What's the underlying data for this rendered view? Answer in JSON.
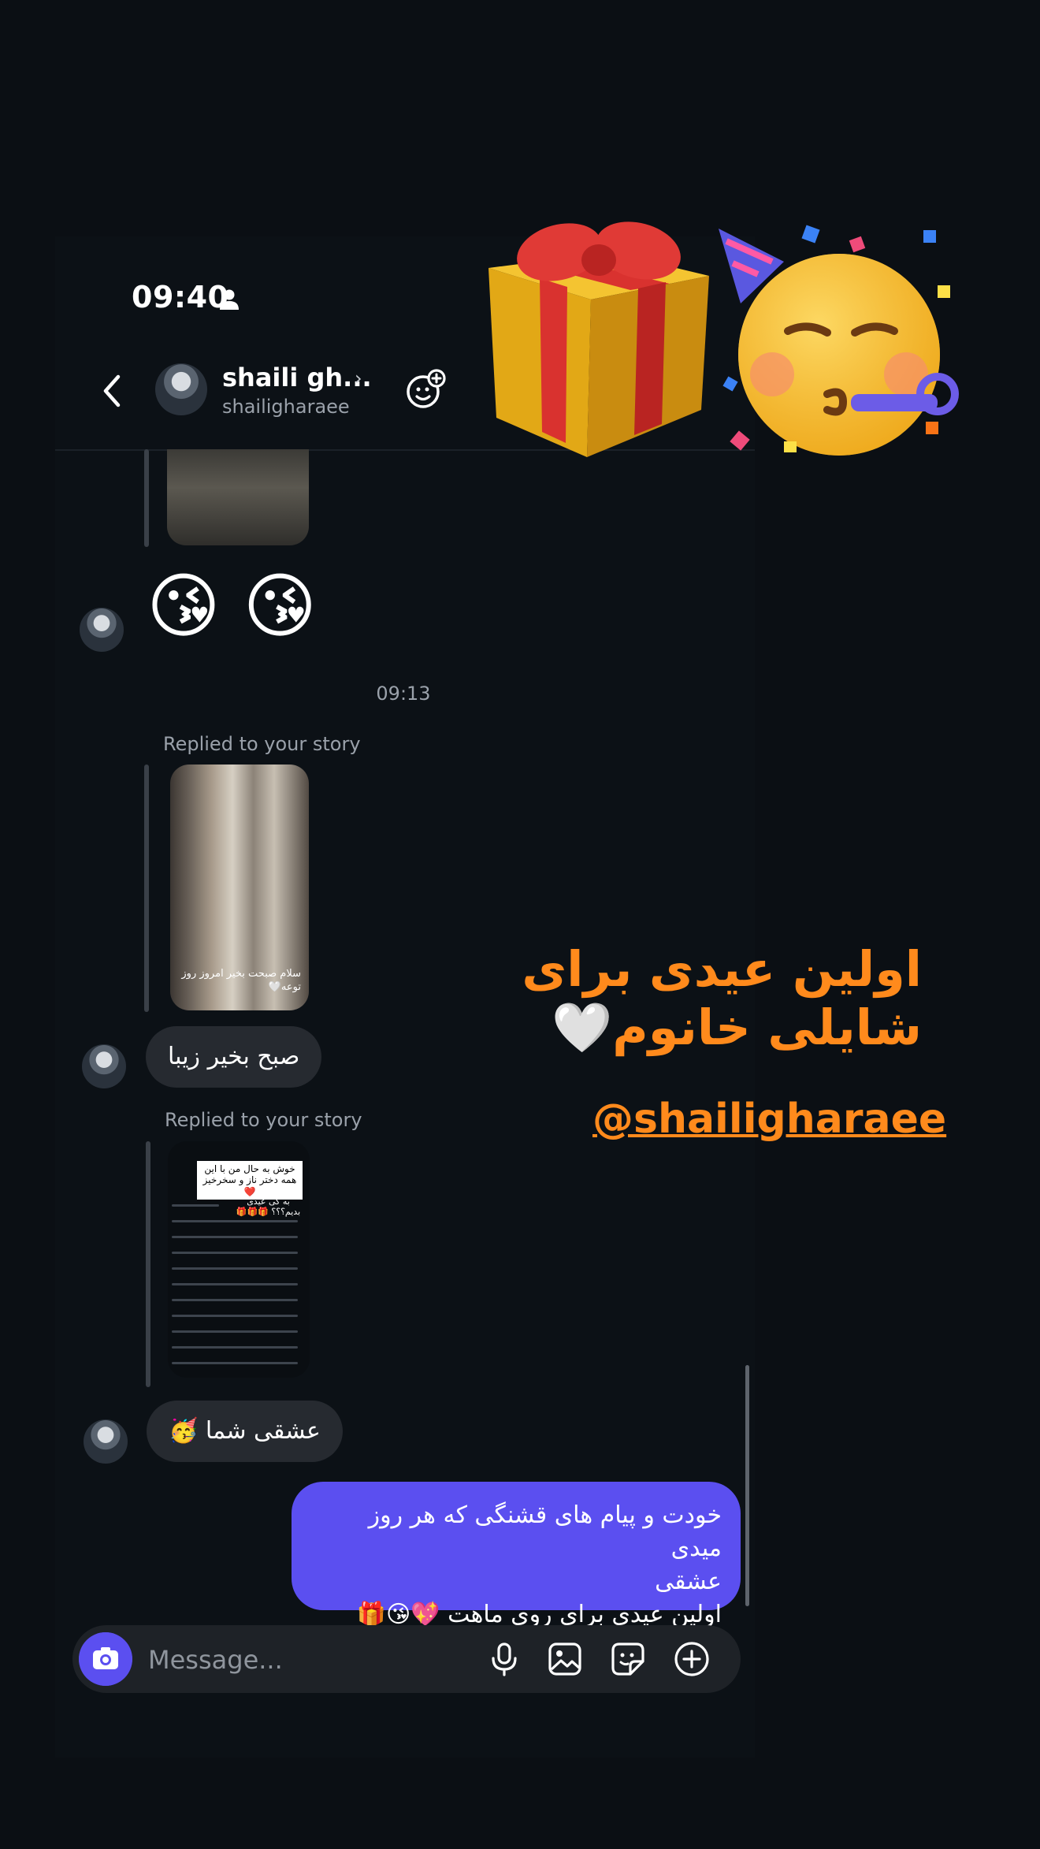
{
  "status_bar": {
    "time": "09:40"
  },
  "header": {
    "name": "shaili gh...",
    "username": "shailigharaee",
    "chevron": "›"
  },
  "thread": {
    "emoji_message": "😘 😘",
    "time_separator": "09:13",
    "reply_label_1": "Replied to your story",
    "story_1_caption": "سلام صبحت بخیر امروز روز توعه🤍",
    "message_1": "صبح بخیر زیبا",
    "reply_label_2": "Replied to your story",
    "story_2_note": "خوش به حال من با این همه دختر ناز و سخرخیز❤️",
    "story_2_ask": "به کی عیدی بدیم؟؟؟ 🎁🎁🎁",
    "message_2": "عشقی شما 🥳",
    "outgoing_line_1": "خودت و پیام های قشنگی که هر روز میدی",
    "outgoing_line_2": "عشقی",
    "outgoing_line_3": "اولین عیدی برای روی ماهت 💖😘🎁"
  },
  "composer": {
    "placeholder": "Message..."
  },
  "story_overlay": {
    "line_1": "اولین عیدی برای",
    "line_2": "شایلی خانوم🤍",
    "mention": "@shailigharaee"
  },
  "stickers": {
    "gift": "gift-emoji",
    "party": "partying-face-emoji"
  },
  "colors": {
    "accent": "#5b4ff0",
    "overlay_text": "#ff8a1c",
    "background": "#0b0f14"
  }
}
